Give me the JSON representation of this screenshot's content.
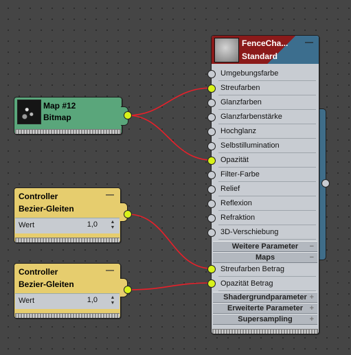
{
  "bitmap_node": {
    "title": "Map #12",
    "subtitle": "Bitmap"
  },
  "controllers": [
    {
      "title": "Controller",
      "subtitle": "Bezier-Gleiten",
      "param_label": "Wert",
      "param_value": "1,0",
      "spinner": "spinner-icon"
    },
    {
      "title": "Controller",
      "subtitle": "Bezier-Gleiten",
      "param_label": "Wert",
      "param_value": "1,0",
      "spinner": "spinner-icon"
    }
  ],
  "material_node": {
    "title": "FenceCha...",
    "subtitle": "Standard",
    "slots": [
      {
        "label": "Umgebungsfarbe",
        "connected": false
      },
      {
        "label": "Streufarben",
        "connected": true
      },
      {
        "label": "Glanzfarben",
        "connected": false
      },
      {
        "label": "Glanzfarbenstärke",
        "connected": false
      },
      {
        "label": "Hochglanz",
        "connected": false
      },
      {
        "label": "Selbstillumination",
        "connected": false
      },
      {
        "label": "Opazität",
        "connected": true
      },
      {
        "label": "Filter-Farbe",
        "connected": false
      },
      {
        "label": "Relief",
        "connected": false
      },
      {
        "label": "Reflexion",
        "connected": false
      },
      {
        "label": "Refraktion",
        "connected": false
      },
      {
        "label": "3D-Verschiebung",
        "connected": false
      }
    ],
    "sections": [
      {
        "label": "Weitere Parameter",
        "icon": "−"
      },
      {
        "label": "Maps",
        "icon": "−"
      }
    ],
    "map_slots": [
      {
        "label": "Streufarben Betrag",
        "connected": true
      },
      {
        "label": "Opazität Betrag",
        "connected": true
      }
    ],
    "collapsed_sections": [
      {
        "label": "Shadergrundparameter",
        "icon": "+"
      },
      {
        "label": "Erweiterte Parameter",
        "icon": "+"
      },
      {
        "label": "Supersampling",
        "icon": "+"
      }
    ]
  },
  "colors": {
    "wire": "#e8202a",
    "socket_active": "#d8f21a",
    "bitmap_header": "#5aa67b",
    "controller_header": "#e6cd6e",
    "material_header": "#8b1a1a"
  }
}
